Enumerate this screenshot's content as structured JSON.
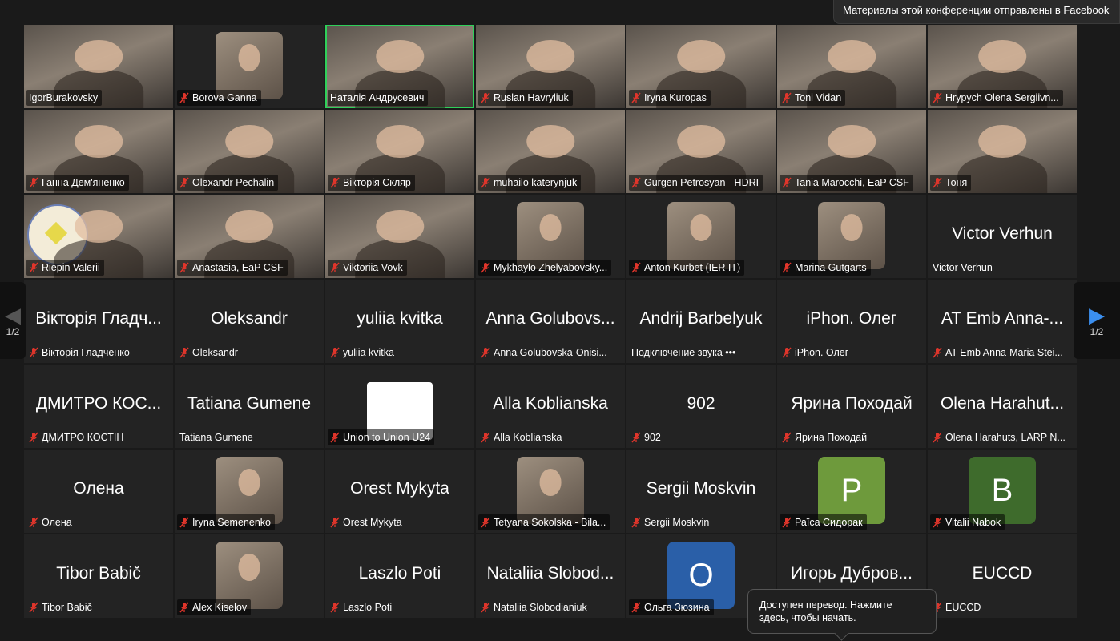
{
  "notification": "Материалы этой конференции отправлены в Facebook",
  "translation_tooltip": {
    "line1": "Доступен перевод. Нажмите",
    "line2": "здесь, чтобы начать."
  },
  "pager": {
    "left_label": "1/2",
    "right_label": "1/2"
  },
  "colors": {
    "speaking_border": "#2fd05a",
    "muted_icon": "#e0352b",
    "pager_arrow": "#3b8ff0"
  },
  "participants": [
    {
      "label": "IgorBurakovsky",
      "kind": "video",
      "muted": false
    },
    {
      "label": "Borova Ganna",
      "kind": "photo",
      "muted": true
    },
    {
      "label": "Наталія Андрусевич",
      "kind": "video",
      "muted": false,
      "speaking": true
    },
    {
      "label": "Ruslan Havryliuk",
      "kind": "video",
      "muted": true
    },
    {
      "label": "Iryna Kuropas",
      "kind": "video",
      "muted": true
    },
    {
      "label": "Toni Vidan",
      "kind": "video",
      "muted": true
    },
    {
      "label": "Hrypych Olena Sergiivn...",
      "kind": "video",
      "muted": true
    },
    {
      "label": "Ганна Дем'яненко",
      "kind": "video",
      "muted": true
    },
    {
      "label": "Olexandr Pechalin",
      "kind": "video",
      "muted": true
    },
    {
      "label": "Вікторія Скляр",
      "kind": "video",
      "muted": true
    },
    {
      "label": "muhailo katerynjuk",
      "kind": "video",
      "muted": true
    },
    {
      "label": "Gurgen Petrosyan - HDRI",
      "kind": "video",
      "muted": true
    },
    {
      "label": "Tania Marocchi, EaP CSF",
      "kind": "video",
      "muted": true
    },
    {
      "label": "Тоня",
      "kind": "video",
      "muted": true
    },
    {
      "label": "Riepin Valerii",
      "kind": "video",
      "muted": true,
      "logo": true
    },
    {
      "label": "Anastasia, EaP CSF",
      "kind": "video",
      "muted": true
    },
    {
      "label": "Viktoriia Vovk",
      "kind": "video",
      "muted": true
    },
    {
      "label": "Mykhaylo Zhelyabovsky...",
      "kind": "photo",
      "muted": true
    },
    {
      "label": "Anton Kurbet (IER IT)",
      "kind": "photo",
      "muted": true
    },
    {
      "label": "Marina Gutgarts",
      "kind": "photo",
      "muted": true
    },
    {
      "label": "Victor Verhun",
      "kind": "name",
      "display": "Victor Verhun",
      "muted": false
    },
    {
      "label": "Вікторія Гладченко",
      "kind": "name",
      "display": "Вікторія Гладч...",
      "muted": true
    },
    {
      "label": "Oleksandr",
      "kind": "name",
      "display": "Oleksandr",
      "muted": true
    },
    {
      "label": "yuliia kvitka",
      "kind": "name",
      "display": "yuliia kvitka",
      "muted": true
    },
    {
      "label": "Anna Golubovska-Onisi...",
      "kind": "name",
      "display": "Anna Golubovs...",
      "muted": true
    },
    {
      "label": "Подключение звука  •••",
      "kind": "name",
      "display": "Andrij Barbelyuk",
      "muted": false
    },
    {
      "label": "iPhon. Олег",
      "kind": "name",
      "display": "iPhon. Олег",
      "muted": true
    },
    {
      "label": "AT Emb Anna-Maria Stei...",
      "kind": "name",
      "display": "AT Emb Anna-...",
      "muted": true
    },
    {
      "label": "ДМИТРО КОСТІН",
      "kind": "name",
      "display": "ДМИТРО КОС...",
      "muted": true
    },
    {
      "label": "Tatiana Gumene",
      "kind": "name",
      "display": "Tatiana Gumene",
      "muted": false
    },
    {
      "label": "Union to Union U24",
      "kind": "white",
      "muted": true
    },
    {
      "label": "Alla Koblianska",
      "kind": "name",
      "display": "Alla Koblianska",
      "muted": true
    },
    {
      "label": "902",
      "kind": "name",
      "display": "902",
      "muted": true
    },
    {
      "label": "Ярина Походай",
      "kind": "name",
      "display": "Ярина Походай",
      "muted": true
    },
    {
      "label": "Olena Harahuts, LARP N...",
      "kind": "name",
      "display": "Olena Harahut...",
      "muted": true
    },
    {
      "label": "Олена",
      "kind": "name",
      "display": "Олена",
      "muted": true
    },
    {
      "label": "Iryna Semenenko",
      "kind": "photo",
      "muted": true
    },
    {
      "label": "Orest Mykyta",
      "kind": "name",
      "display": "Orest Mykyta",
      "muted": true
    },
    {
      "label": "Tetyana Sokolska - Bila...",
      "kind": "photo",
      "muted": true
    },
    {
      "label": "Sergii Moskvin",
      "kind": "name",
      "display": "Sergii Moskvin",
      "muted": true
    },
    {
      "label": "Раїса Сидорак",
      "kind": "avatar",
      "letter": "Р",
      "color": "#6e9a3c",
      "muted": true
    },
    {
      "label": "Vitalii Nabok",
      "kind": "avatar",
      "letter": "В",
      "color": "#3e6b2c",
      "muted": true
    },
    {
      "label": "Tibor Babič",
      "kind": "name",
      "display": "Tibor Babič",
      "muted": true
    },
    {
      "label": "Alex Kiselov",
      "kind": "photo",
      "muted": true
    },
    {
      "label": "Laszlo Poti",
      "kind": "name",
      "display": "Laszlo Poti",
      "muted": true
    },
    {
      "label": "Nataliia Slobodianiuk",
      "kind": "name",
      "display": "Nataliia Slobod...",
      "muted": true
    },
    {
      "label": "Ольга Зюзина",
      "kind": "avatar",
      "letter": "О",
      "color": "#2a5fa8",
      "muted": true
    },
    {
      "label": "Игорь Дубровин",
      "kind": "name",
      "display": "Игорь Дубров...",
      "muted": true
    },
    {
      "label": "EUCCD",
      "kind": "name",
      "display": "EUCCD",
      "muted": true
    }
  ]
}
